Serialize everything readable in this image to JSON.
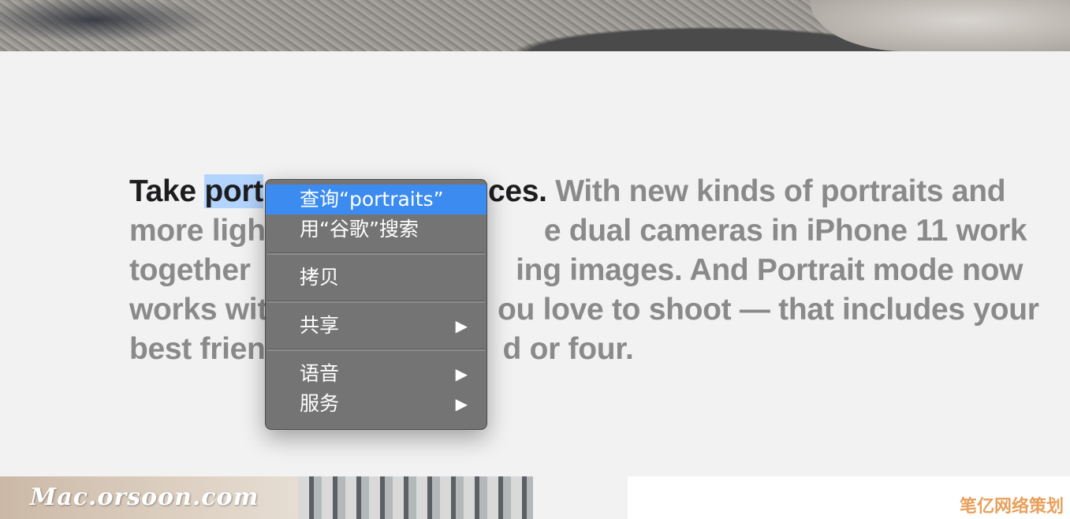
{
  "paragraph": {
    "lead_before": "Take ",
    "lead_selected": "port",
    "lead_after": "",
    "lead_end": "ces.",
    "line1_rest": " With new kinds of portraits and",
    "line2": "more ligh",
    "line2_rest": "e dual cameras in iPhone 11 work",
    "line3": "together ",
    "line3_rest": "ing images. And Portrait mode now",
    "line4": "works wit",
    "line4_rest": "ou love to shoot — that includes your",
    "line5": "best frien",
    "line5_rest": "d or four."
  },
  "context_menu": {
    "items": [
      {
        "label": "查询“portraits”",
        "highlighted": true
      },
      {
        "label": "用“谷歌”搜索"
      },
      {
        "label": "拷贝"
      },
      {
        "label": "共享",
        "submenu": "▶"
      },
      {
        "label": "语音",
        "submenu": "▶"
      },
      {
        "label": "服务",
        "submenu": "▶"
      }
    ]
  },
  "watermarks": {
    "left": "Mac.orsoon.com",
    "right": "笔亿网络策划"
  },
  "colors": {
    "highlight": "#3b8bf0",
    "selection": "#b3d4fc",
    "text_dark": "#1d1d1f",
    "text_gray": "#8a8a8a"
  }
}
